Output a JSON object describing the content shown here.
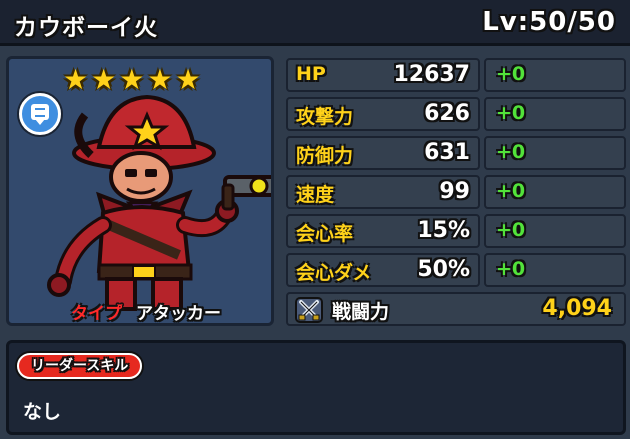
{
  "header": {
    "character_name": "カウボーイ火",
    "level": "Lv:50/50"
  },
  "portrait": {
    "star_count": 5,
    "star_glyph": "★",
    "type_label": "タイプ",
    "type_value": "アタッカー"
  },
  "stats": [
    {
      "label": "HP",
      "value": "12637",
      "bonus": "+0"
    },
    {
      "label": "攻撃力",
      "value": "626",
      "bonus": "+0"
    },
    {
      "label": "防御力",
      "value": "631",
      "bonus": "+0"
    },
    {
      "label": "速度",
      "value": "99",
      "bonus": "+0"
    },
    {
      "label": "会心率",
      "value": "15%",
      "bonus": "+0"
    },
    {
      "label": "会心ダメ",
      "value": "50%",
      "bonus": "+0"
    }
  ],
  "power": {
    "label": "戦闘力",
    "value": "4,094"
  },
  "leader_skill": {
    "tag": "リーダースキル",
    "text": "なし"
  },
  "colors": {
    "background": "#2f3b4b",
    "stat_label": "#ffd21a",
    "bonus": "#52e23a",
    "skill_tag": "#e6291f",
    "type_label": "#ff2a2a"
  }
}
